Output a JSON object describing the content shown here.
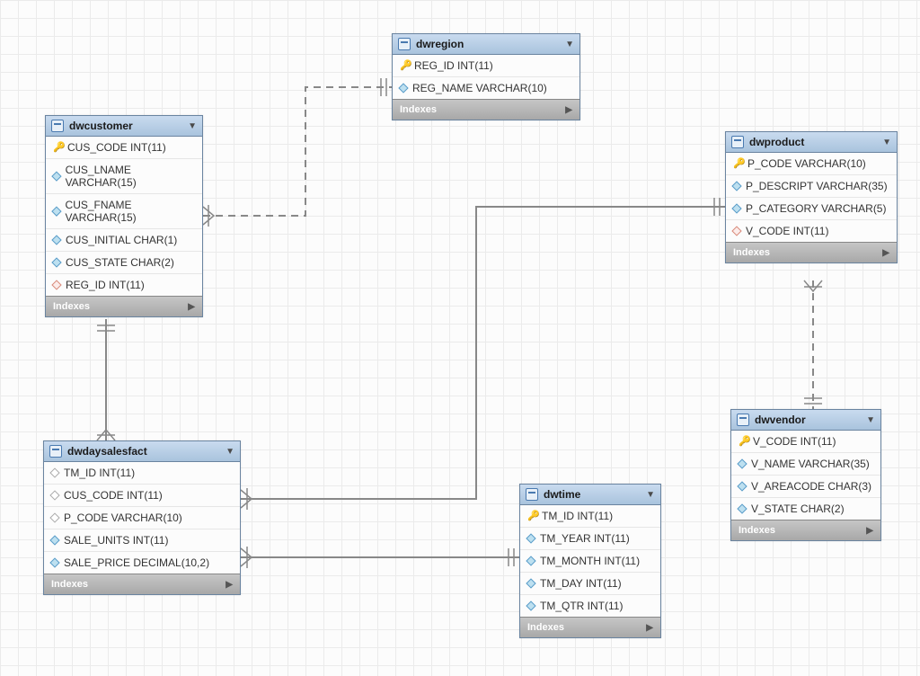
{
  "diagram": {
    "indexes_label": "Indexes"
  },
  "tables": {
    "dwregion": {
      "title": "dwregion",
      "cols": [
        {
          "icon": "key",
          "name": "REG_ID INT(11)"
        },
        {
          "icon": "blue",
          "name": "REG_NAME VARCHAR(10)"
        }
      ]
    },
    "dwcustomer": {
      "title": "dwcustomer",
      "cols": [
        {
          "icon": "key",
          "name": "CUS_CODE INT(11)"
        },
        {
          "icon": "blue",
          "name": "CUS_LNAME VARCHAR(15)"
        },
        {
          "icon": "blue",
          "name": "CUS_FNAME VARCHAR(15)"
        },
        {
          "icon": "blue",
          "name": "CUS_INITIAL CHAR(1)"
        },
        {
          "icon": "blue",
          "name": "CUS_STATE CHAR(2)"
        },
        {
          "icon": "red",
          "name": "REG_ID INT(11)"
        }
      ]
    },
    "dwproduct": {
      "title": "dwproduct",
      "cols": [
        {
          "icon": "key",
          "name": "P_CODE VARCHAR(10)"
        },
        {
          "icon": "blue",
          "name": "P_DESCRIPT VARCHAR(35)"
        },
        {
          "icon": "blue",
          "name": "P_CATEGORY VARCHAR(5)"
        },
        {
          "icon": "red",
          "name": "V_CODE INT(11)"
        }
      ]
    },
    "dwvendor": {
      "title": "dwvendor",
      "cols": [
        {
          "icon": "key",
          "name": "V_CODE INT(11)"
        },
        {
          "icon": "blue",
          "name": "V_NAME VARCHAR(35)"
        },
        {
          "icon": "blue",
          "name": "V_AREACODE CHAR(3)"
        },
        {
          "icon": "blue",
          "name": "V_STATE CHAR(2)"
        }
      ]
    },
    "dwtime": {
      "title": "dwtime",
      "cols": [
        {
          "icon": "key",
          "name": "TM_ID INT(11)"
        },
        {
          "icon": "blue",
          "name": "TM_YEAR INT(11)"
        },
        {
          "icon": "blue",
          "name": "TM_MONTH INT(11)"
        },
        {
          "icon": "blue",
          "name": "TM_DAY INT(11)"
        },
        {
          "icon": "blue",
          "name": "TM_QTR INT(11)"
        }
      ]
    },
    "dwdaysalesfact": {
      "title": "dwdaysalesfact",
      "cols": [
        {
          "icon": "plain",
          "name": "TM_ID INT(11)"
        },
        {
          "icon": "plain",
          "name": "CUS_CODE INT(11)"
        },
        {
          "icon": "plain",
          "name": "P_CODE VARCHAR(10)"
        },
        {
          "icon": "blue",
          "name": "SALE_UNITS INT(11)"
        },
        {
          "icon": "blue",
          "name": "SALE_PRICE DECIMAL(10,2)"
        }
      ]
    }
  },
  "relationships": [
    {
      "from": "dwcustomer",
      "to": "dwregion",
      "style": "dashed"
    },
    {
      "from": "dwdaysalesfact",
      "to": "dwcustomer",
      "style": "solid"
    },
    {
      "from": "dwdaysalesfact",
      "to": "dwproduct",
      "style": "solid"
    },
    {
      "from": "dwdaysalesfact",
      "to": "dwtime",
      "style": "solid"
    },
    {
      "from": "dwproduct",
      "to": "dwvendor",
      "style": "dashed"
    }
  ]
}
